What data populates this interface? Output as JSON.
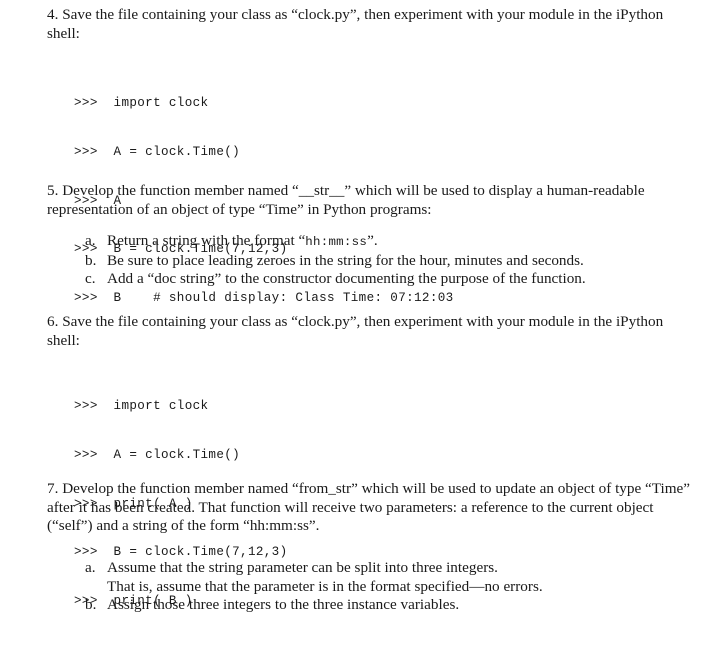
{
  "document": {
    "type": "assignment-worksheet",
    "background_color": "#ffffff",
    "text_color": "#1a1a1a"
  },
  "sections": [
    {
      "number": "4.",
      "text": "Save the file containing your class as “clock.py”, then experiment with your module in the iPython shell:"
    },
    {
      "number": "5.",
      "text_before": "Develop the function member named “__str__” which will be used to display a human-readable representation of an object of type “Time” in Python programs:"
    },
    {
      "number": "6.",
      "text": "Save the file containing your class as “clock.py”, then experiment with your module in the iPython shell:"
    },
    {
      "number": "7.",
      "text": "Develop the function member named “from_str” which will be used to update an object of type “Time” after it has been created.  That function will receive two parameters:  a reference to the current object (“self”) and a string of the form “hh:mm:ss”."
    }
  ],
  "code_block_1": {
    "lines": [
      ">>>  import clock",
      ">>>  A = clock.Time()",
      ">>>  A",
      ">>>  B = clock.Time(7,12,3)",
      ">>>  B    # should display: Class Time: 07:12:03"
    ]
  },
  "code_block_2": {
    "lines": [
      ">>>  import clock",
      ">>>  A = clock.Time()",
      ">>>  print( A )",
      ">>>  B = clock.Time(7,12,3)",
      ">>>  print( B )"
    ]
  },
  "list_5": {
    "items": [
      {
        "letter": "a.",
        "text_before": "Return a string with the format “",
        "mono": "hh:mm:ss",
        "text_after": "”."
      },
      {
        "letter": "b.",
        "text_before": "Be sure to place leading zeroes in the string for the hour, minutes and seconds.",
        "mono": "",
        "text_after": ""
      },
      {
        "letter": "c.",
        "text_before": "Add a “doc string” to the constructor documenting the purpose of the function.",
        "mono": "",
        "text_after": ""
      }
    ]
  },
  "list_7": {
    "items": [
      {
        "letter": "a.",
        "line1": "Assume that the string parameter can be split into three integers.",
        "line2": "That is, assume that the parameter is in the format specified—no errors."
      },
      {
        "letter": "b.",
        "line1": "Assign those three integers to the three instance variables.",
        "line2": ""
      }
    ]
  }
}
